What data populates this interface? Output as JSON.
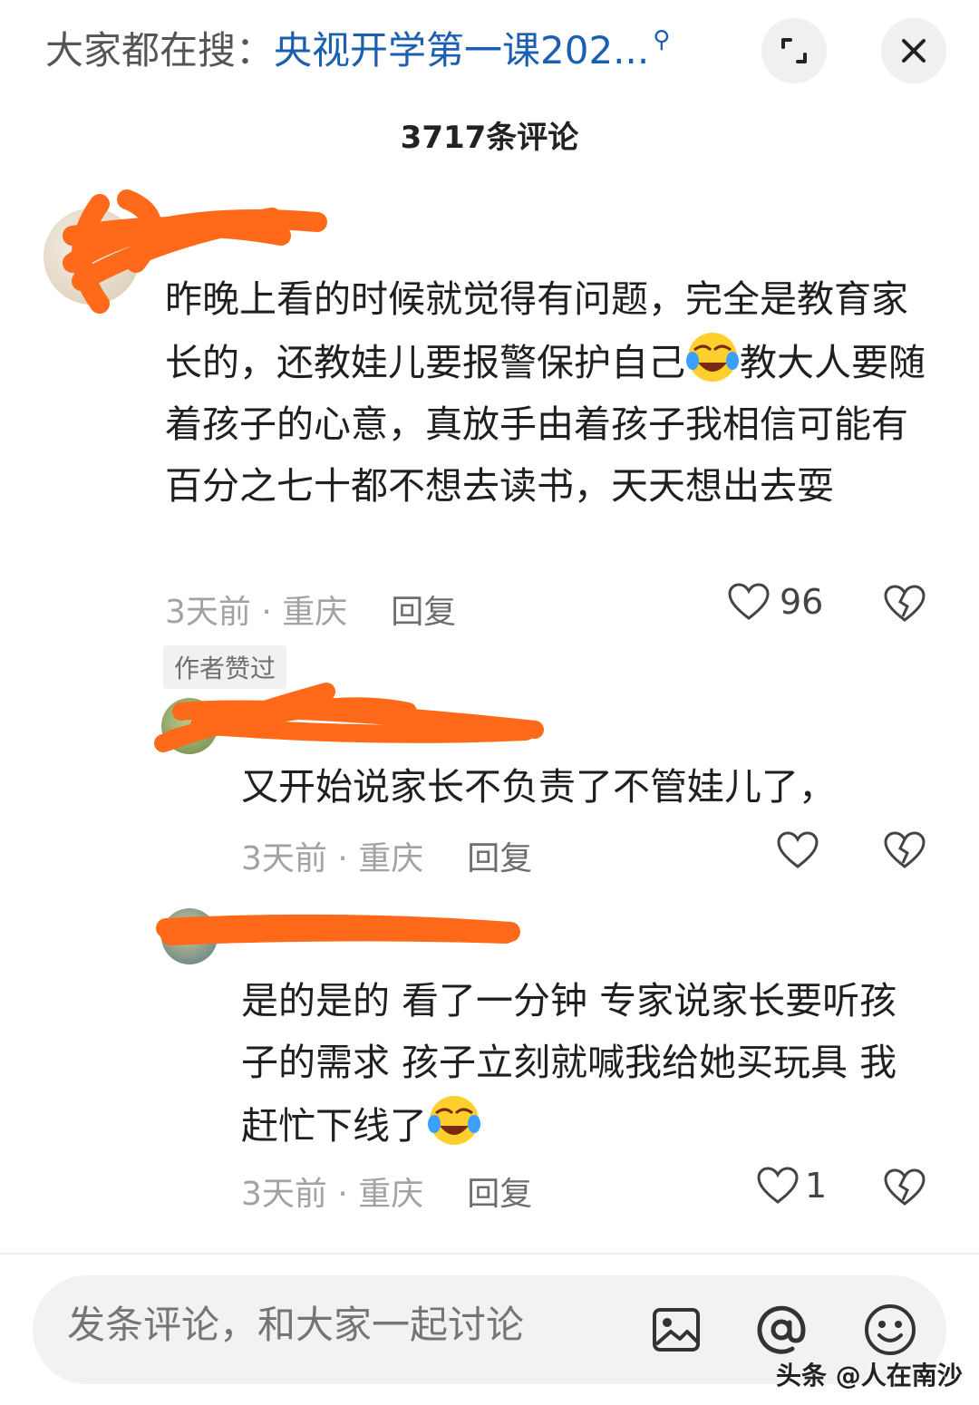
{
  "topbar": {
    "search_prefix": "大家都在搜：",
    "search_query": "央视开学第一课202...",
    "expand_icon": "collapse-corners-icon",
    "close_icon": "close-icon"
  },
  "comment_count": "3717条评论",
  "comments": [
    {
      "text": "昨晚上看的时候就觉得有问题，完全是教育家长的，还教娃儿要报警保护自己",
      "text_after_emoji": "教大人要随着孩子的心意，真放手由着孩子我相信可能有百分之七十都不想去读书，天天想出去耍",
      "meta": "3天前 · 重庆",
      "reply": "回复",
      "likes": "96",
      "badge": "作者赞过"
    },
    {
      "text": "又开始说家长不负责了不管娃儿了，",
      "meta": "3天前 · 重庆",
      "reply": "回复",
      "likes": ""
    },
    {
      "text": "是的是的 看了一分钟 专家说家长要听孩子的需求 孩子立刻就喊我给她买玩具 我赶忙下线了",
      "meta": "3天前 · 重庆",
      "reply": "回复",
      "likes": "1"
    }
  ],
  "composer": {
    "placeholder": "发条评论，和大家一起讨论",
    "icons": [
      "image-icon",
      "at-icon",
      "emoji-icon"
    ]
  },
  "watermark": "头条 @人在南沙",
  "colors": {
    "accent_blue": "#1b5fb0",
    "scribble_orange": "#ff6a1a",
    "meta_gray": "#a2a2a2"
  }
}
